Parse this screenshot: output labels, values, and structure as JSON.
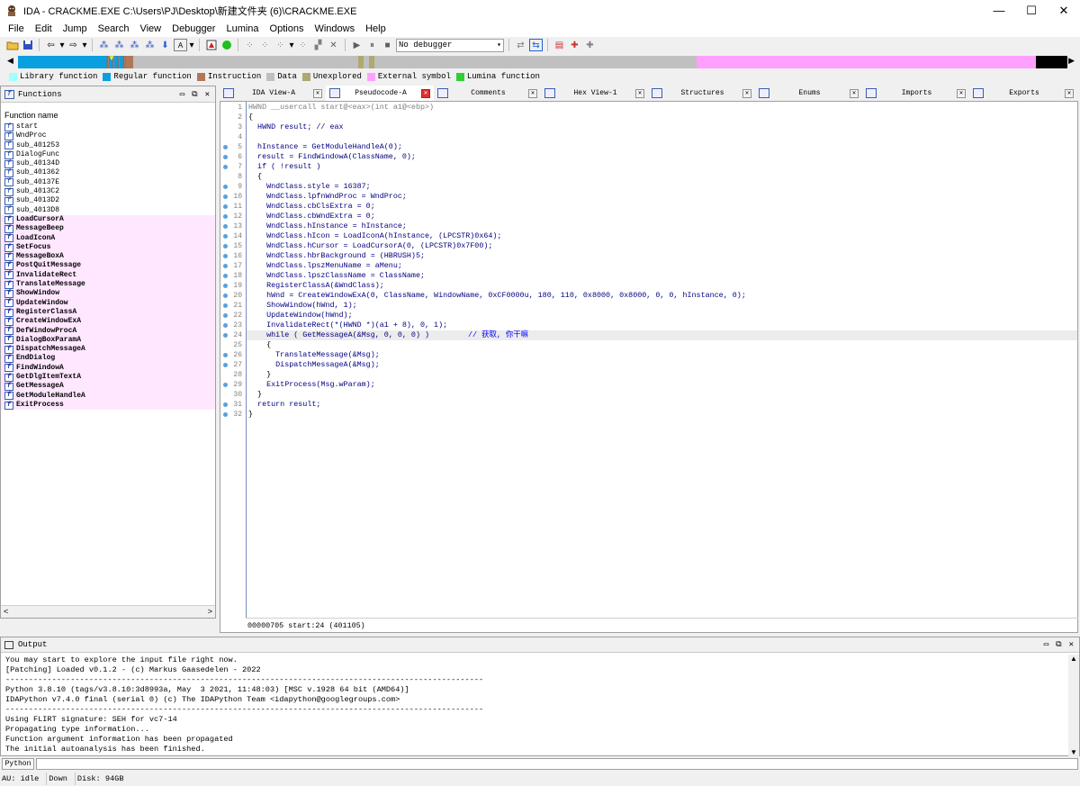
{
  "window": {
    "title": "IDA - CRACKME.EXE C:\\Users\\PJ\\Desktop\\新建文件夹 (6)\\CRACKME.EXE",
    "minimize": "—",
    "maximize": "☐",
    "close": "✕"
  },
  "menu": [
    "File",
    "Edit",
    "Jump",
    "Search",
    "View",
    "Debugger",
    "Lumina",
    "Options",
    "Windows",
    "Help"
  ],
  "toolbar": {
    "debugger_select": "No debugger"
  },
  "navband": {
    "colors": {
      "library": "#7fffff",
      "regular": "#0aa0e0",
      "instruction": "#b07858",
      "data": "#c0c0c0",
      "unexplored": "#b0a870",
      "external": "#ffa0ff",
      "lumina": "#30d030",
      "unknown": "#000000"
    }
  },
  "legend": [
    {
      "label": "Library function",
      "color": "#a0ffff"
    },
    {
      "label": "Regular function",
      "color": "#0aa0e0"
    },
    {
      "label": "Instruction",
      "color": "#b07858"
    },
    {
      "label": "Data",
      "color": "#c0c0c0"
    },
    {
      "label": "Unexplored",
      "color": "#b0a870"
    },
    {
      "label": "External symbol",
      "color": "#ffa0ff"
    },
    {
      "label": "Lumina function",
      "color": "#30d030"
    }
  ],
  "functions_panel": {
    "title": "Functions",
    "column": "Function name",
    "items": [
      {
        "name": "start",
        "ext": false
      },
      {
        "name": "WndProc",
        "ext": false
      },
      {
        "name": "sub_401253",
        "ext": false
      },
      {
        "name": "DialogFunc",
        "ext": false
      },
      {
        "name": "sub_40134D",
        "ext": false
      },
      {
        "name": "sub_401362",
        "ext": false
      },
      {
        "name": "sub_40137E",
        "ext": false
      },
      {
        "name": "sub_4013C2",
        "ext": false
      },
      {
        "name": "sub_4013D2",
        "ext": false
      },
      {
        "name": "sub_4013D8",
        "ext": false
      },
      {
        "name": "LoadCursorA",
        "ext": true
      },
      {
        "name": "MessageBeep",
        "ext": true
      },
      {
        "name": "LoadIconA",
        "ext": true
      },
      {
        "name": "SetFocus",
        "ext": true
      },
      {
        "name": "MessageBoxA",
        "ext": true
      },
      {
        "name": "PostQuitMessage",
        "ext": true
      },
      {
        "name": "InvalidateRect",
        "ext": true
      },
      {
        "name": "TranslateMessage",
        "ext": true
      },
      {
        "name": "ShowWindow",
        "ext": true
      },
      {
        "name": "UpdateWindow",
        "ext": true
      },
      {
        "name": "RegisterClassA",
        "ext": true
      },
      {
        "name": "CreateWindowExA",
        "ext": true
      },
      {
        "name": "DefWindowProcA",
        "ext": true
      },
      {
        "name": "DialogBoxParamA",
        "ext": true
      },
      {
        "name": "DispatchMessageA",
        "ext": true
      },
      {
        "name": "EndDialog",
        "ext": true
      },
      {
        "name": "FindWindowA",
        "ext": true
      },
      {
        "name": "GetDlgItemTextA",
        "ext": true
      },
      {
        "name": "GetMessageA",
        "ext": true
      },
      {
        "name": "GetModuleHandleA",
        "ext": true
      },
      {
        "name": "ExitProcess",
        "ext": true
      }
    ]
  },
  "tabs": [
    {
      "label": "IDA View-A",
      "active": false,
      "width": 118
    },
    {
      "label": "Pseudocode-A",
      "active": true,
      "width": 120
    },
    {
      "label": "Comments",
      "active": false,
      "width": 119
    },
    {
      "label": "Hex View-1",
      "active": false,
      "width": 119
    },
    {
      "label": "Structures",
      "active": false,
      "width": 119
    },
    {
      "label": "Enums",
      "active": false,
      "width": 119
    },
    {
      "label": "Imports",
      "active": false,
      "width": 119
    },
    {
      "label": "Exports",
      "active": false,
      "width": 120
    }
  ],
  "code": {
    "lines": [
      {
        "n": "1",
        "text": "HWND __usercall start@<eax>(int a1@<ebp>)",
        "dot": false,
        "cls": "c-g"
      },
      {
        "n": "2",
        "text": "{",
        "dot": false,
        "cls": ""
      },
      {
        "n": "3",
        "text": "  HWND result; // eax",
        "dot": false,
        "cls": "c-n"
      },
      {
        "n": "4",
        "text": "",
        "dot": false,
        "cls": ""
      },
      {
        "n": "5",
        "text": "  hInstance = GetModuleHandleA(0);",
        "dot": true,
        "cls": "c-n"
      },
      {
        "n": "6",
        "text": "  result = FindWindowA(ClassName, 0);",
        "dot": true,
        "cls": "c-n"
      },
      {
        "n": "7",
        "text": "  if ( !result )",
        "dot": true,
        "cls": "c-n"
      },
      {
        "n": "8",
        "text": "  {",
        "dot": false,
        "cls": ""
      },
      {
        "n": "9",
        "text": "    WndClass.style = 16387;",
        "dot": true,
        "cls": "c-n"
      },
      {
        "n": "10",
        "text": "    WndClass.lpfnWndProc = WndProc;",
        "dot": true,
        "cls": "c-n"
      },
      {
        "n": "11",
        "text": "    WndClass.cbClsExtra = 0;",
        "dot": true,
        "cls": "c-n"
      },
      {
        "n": "12",
        "text": "    WndClass.cbWndExtra = 0;",
        "dot": true,
        "cls": "c-n"
      },
      {
        "n": "13",
        "text": "    WndClass.hInstance = hInstance;",
        "dot": true,
        "cls": "c-n"
      },
      {
        "n": "14",
        "text": "    WndClass.hIcon = LoadIconA(hInstance, (LPCSTR)0x64);",
        "dot": true,
        "cls": "c-n"
      },
      {
        "n": "15",
        "text": "    WndClass.hCursor = LoadCursorA(0, (LPCSTR)0x7F00);",
        "dot": true,
        "cls": "c-n"
      },
      {
        "n": "16",
        "text": "    WndClass.hbrBackground = (HBRUSH)5;",
        "dot": true,
        "cls": "c-n"
      },
      {
        "n": "17",
        "text": "    WndClass.lpszMenuName = aMenu;",
        "dot": true,
        "cls": "c-n"
      },
      {
        "n": "18",
        "text": "    WndClass.lpszClassName = ClassName;",
        "dot": true,
        "cls": "c-n"
      },
      {
        "n": "19",
        "text": "    RegisterClassA(&WndClass);",
        "dot": true,
        "cls": "c-n"
      },
      {
        "n": "20",
        "text": "    hWnd = CreateWindowExA(0, ClassName, WindowName, 0xCF0000u, 180, 110, 0x8000, 0x8000, 0, 0, hInstance, 0);",
        "dot": true,
        "cls": "c-n"
      },
      {
        "n": "21",
        "text": "    ShowWindow(hWnd, 1);",
        "dot": true,
        "cls": "c-n"
      },
      {
        "n": "22",
        "text": "    UpdateWindow(hWnd);",
        "dot": true,
        "cls": "c-n"
      },
      {
        "n": "23",
        "text": "    InvalidateRect(*(HWND *)(a1 + 8), 0, 1);",
        "dot": true,
        "cls": "c-n"
      },
      {
        "n": "24",
        "text": "    while ( GetMessageA(&Msg, 0, 0, 0) )",
        "dot": true,
        "cls": "c-n",
        "comment": "// 获取, 你干嘛"
      },
      {
        "n": "25",
        "text": "    {",
        "dot": false,
        "cls": ""
      },
      {
        "n": "26",
        "text": "      TranslateMessage(&Msg);",
        "dot": true,
        "cls": "c-n"
      },
      {
        "n": "27",
        "text": "      DispatchMessageA(&Msg);",
        "dot": true,
        "cls": "c-n"
      },
      {
        "n": "28",
        "text": "    }",
        "dot": false,
        "cls": ""
      },
      {
        "n": "29",
        "text": "    ExitProcess(Msg.wParam);",
        "dot": true,
        "cls": "c-n"
      },
      {
        "n": "30",
        "text": "  }",
        "dot": false,
        "cls": ""
      },
      {
        "n": "31",
        "text": "  return result;",
        "dot": true,
        "cls": "c-n"
      },
      {
        "n": "32",
        "text": "}",
        "dot": true,
        "cls": ""
      }
    ],
    "highlight_line": 24,
    "status": "00000705 start:24 (401105)"
  },
  "output": {
    "title": "Output",
    "lines": [
      "You may start to explore the input file right now.",
      "[Patching] Loaded v0.1.2 - (c) Markus Gaasedelen - 2022",
      "-------------------------------------------------------------------------------------------------------",
      "Python 3.8.10 (tags/v3.8.10:3d8993a, May  3 2021, 11:48:03) [MSC v.1928 64 bit (AMD64)]",
      "IDAPython v7.4.0 final (serial 0) (c) The IDAPython Team <idapython@googlegroups.com>",
      "-------------------------------------------------------------------------------------------------------",
      "Using FLIRT signature: SEH for vc7-14",
      "Propagating type information...",
      "Function argument information has been propagated",
      "The initial autoanalysis has been finished."
    ]
  },
  "python": {
    "label": "Python"
  },
  "status": {
    "au": "AU:  idle",
    "dir": "Down",
    "disk": "Disk: 94GB"
  }
}
